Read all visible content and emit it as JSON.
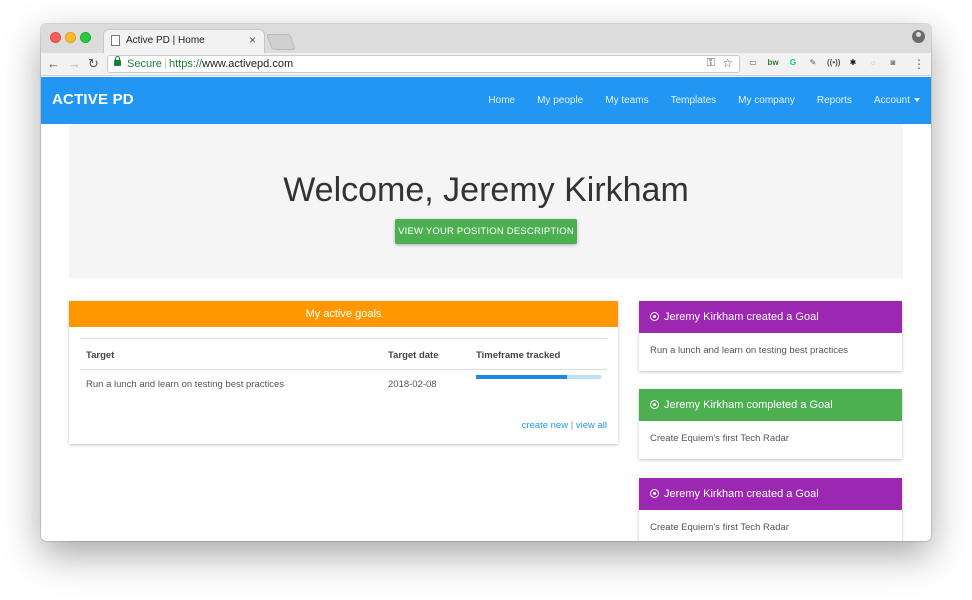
{
  "browser": {
    "tab_title": "Active PD | Home",
    "tab_close": "×",
    "secure_label": "Secure",
    "url_scheme": "https://",
    "url_rest": "www.activepd.com",
    "back_glyph": "←",
    "forward_glyph": "→",
    "reload_glyph": "↻",
    "key_glyph": "⚿",
    "star_glyph": "☆",
    "menu_glyph": "⋮",
    "extensions": [
      {
        "name": "cast-icon",
        "glyph": "▭",
        "color": "#555555"
      },
      {
        "name": "bw-extension-icon",
        "glyph": "bw",
        "color": "#2e7d32"
      },
      {
        "name": "grammarly-icon",
        "glyph": "G",
        "color": "#15c39a"
      },
      {
        "name": "eyedropper-icon",
        "glyph": "✎",
        "color": "#555555"
      },
      {
        "name": "rss-icon",
        "glyph": "((•))",
        "color": "#555555"
      },
      {
        "name": "star-extension-icon",
        "glyph": "✱",
        "color": "#111111"
      },
      {
        "name": "sun-extension-icon",
        "glyph": "☼",
        "color": "#bbbbbb"
      },
      {
        "name": "camera-icon",
        "glyph": "◙",
        "color": "#777777"
      }
    ]
  },
  "app": {
    "brand": "ACTIVE PD",
    "nav": [
      "Home",
      "My people",
      "My teams",
      "Templates",
      "My company",
      "Reports"
    ],
    "account_label": "Account",
    "welcome": "Welcome, Jeremy Kirkham",
    "position_button": "VIEW YOUR POSITION DESCRIPTION",
    "accent_color": "#2196f3"
  },
  "goals": {
    "title": "My active goals",
    "columns": [
      "Target",
      "Target date",
      "Timeframe tracked"
    ],
    "rows": [
      {
        "target": "Run a lunch and learn on testing best practices",
        "date": "2018-02-08",
        "progress": 0.73
      }
    ],
    "create_new": "create new",
    "separator": "|",
    "view_all": "view all"
  },
  "activity": [
    {
      "title": "Jeremy Kirkham created a Goal",
      "body": "Run a lunch and learn on testing best practices",
      "color": "#9c27b0"
    },
    {
      "title": "Jeremy Kirkham completed a Goal",
      "body": "Create Equiem's first Tech Radar",
      "color": "#4caf50"
    },
    {
      "title": "Jeremy Kirkham created a Goal",
      "body": "Create Equiem's first Tech Radar",
      "color": "#9c27b0"
    }
  ]
}
